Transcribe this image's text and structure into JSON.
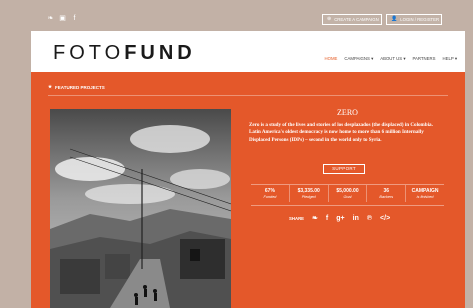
{
  "topbar": {
    "social": [
      {
        "name": "twitter-icon",
        "glyph": "❧"
      },
      {
        "name": "instagram-icon",
        "glyph": "▣"
      },
      {
        "name": "facebook-icon",
        "glyph": "f"
      }
    ],
    "create_campaign": "CREATE A CAMPAIGN",
    "login_register": "LOGIN / REGISTER"
  },
  "header": {
    "logo_light": "FOTO",
    "logo_bold": "FUND",
    "nav": [
      "HOME",
      "CAMPAIGNS ▾",
      "ABOUT US ▾",
      "PARTNERS",
      "HELP ▾"
    ]
  },
  "featured": {
    "label": "FEATURED PROJECTS"
  },
  "project": {
    "title": "ZERO",
    "description": "Zero is a study of the lives and stories of los desplazados (the displaced) in Colombia. Latin America's oldest democracy is now home to more than 6 million Internally Displaced Persons (IDPs) – second in the world only to Syria.",
    "support_label": "SUPPORT",
    "stats": [
      {
        "value": "67%",
        "label": "Funded"
      },
      {
        "value": "$3,335.00",
        "label": "Pledged"
      },
      {
        "value": "$5,000.00",
        "label": "Goal"
      },
      {
        "value": "36",
        "label": "Backers"
      },
      {
        "value": "CAMPAIGN",
        "label": "is finished"
      }
    ],
    "share_label": "SHARE",
    "share_icons": [
      {
        "name": "twitter-icon",
        "glyph": "❧"
      },
      {
        "name": "facebook-icon",
        "glyph": "f"
      },
      {
        "name": "google-plus-icon",
        "glyph": "g+"
      },
      {
        "name": "linkedin-icon",
        "glyph": "in"
      },
      {
        "name": "pinterest-icon",
        "glyph": "℗"
      },
      {
        "name": "embed-icon",
        "glyph": "</>"
      }
    ]
  },
  "colors": {
    "accent": "#e4582a",
    "background": "#c2b1a6"
  }
}
